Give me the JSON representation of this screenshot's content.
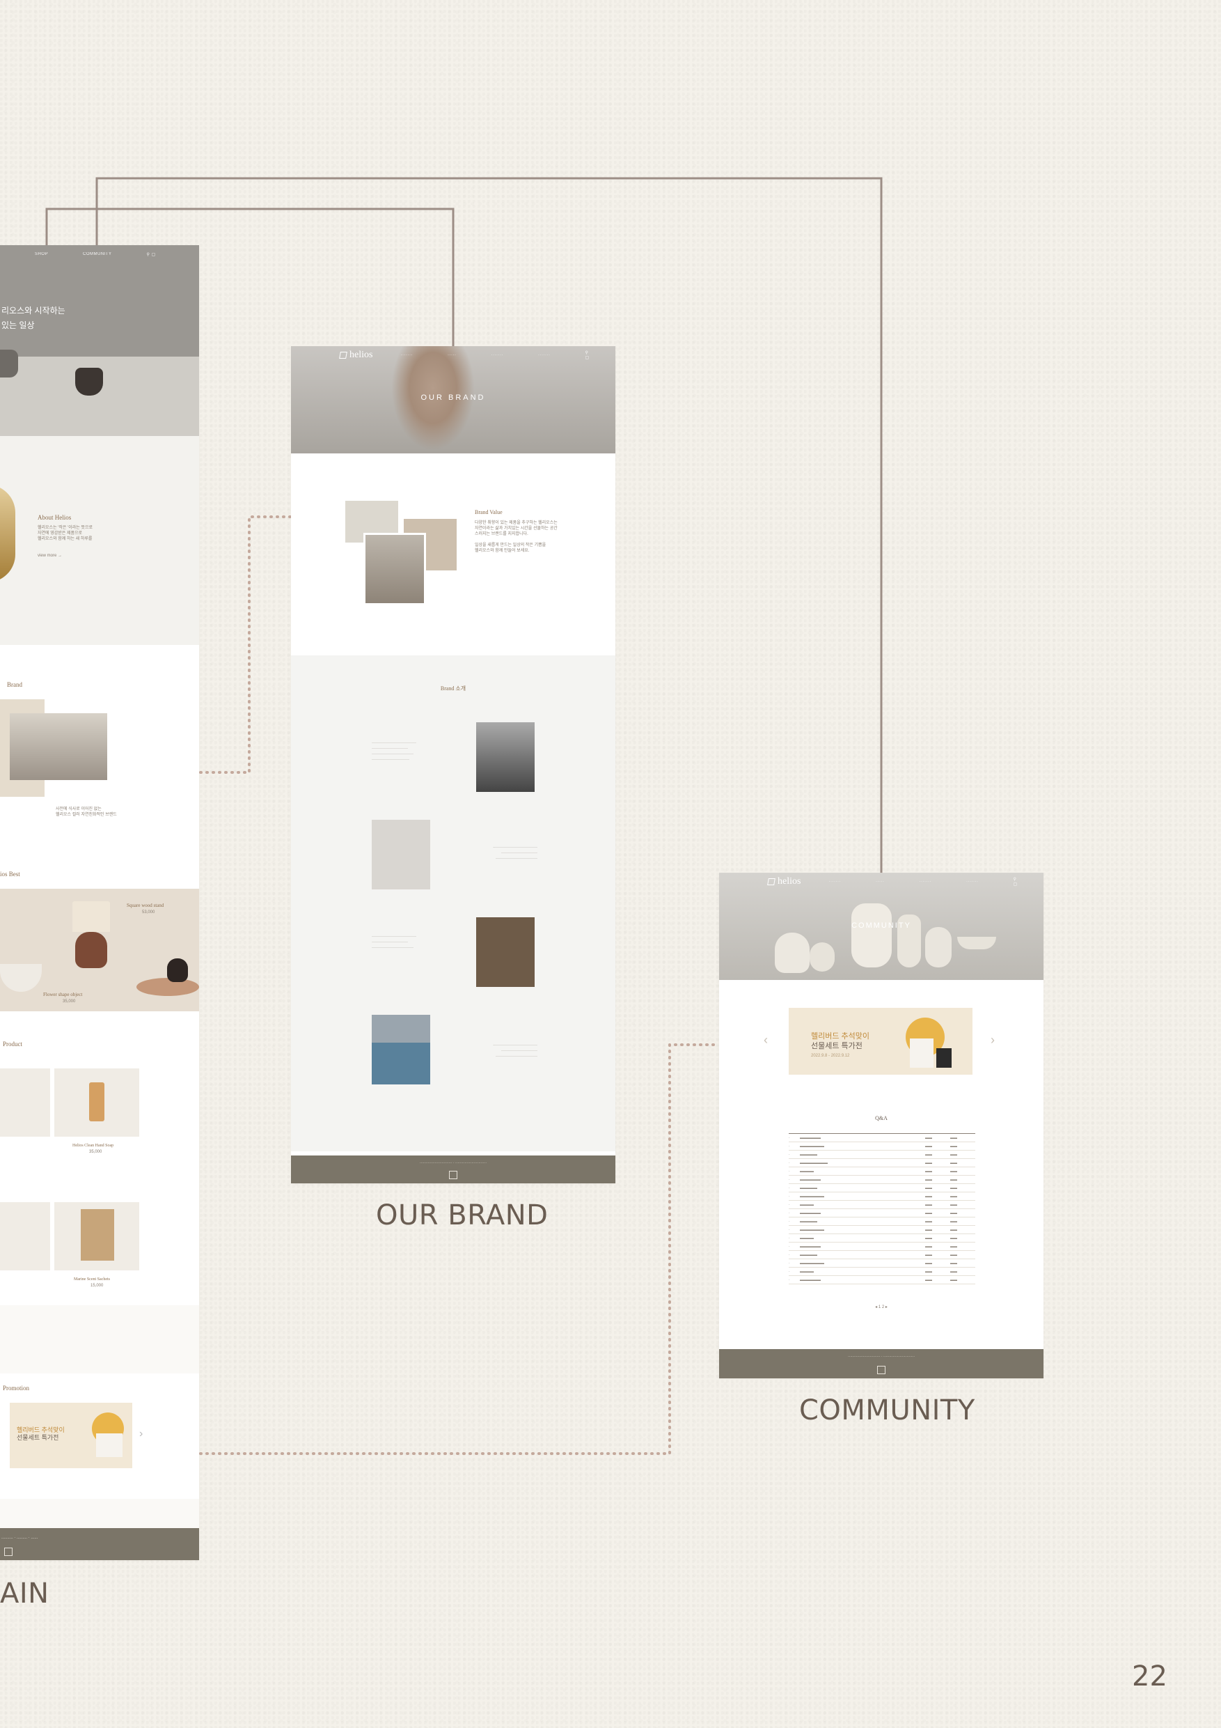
{
  "page_number": "22",
  "main": {
    "nav": [
      "SHOP",
      "COMMUNITY"
    ],
    "hero_text": [
      "리오스와 시작하는",
      "있는 일상"
    ],
    "about_title": "About Helios",
    "brand_section": "Brand",
    "best_section": "ios Best",
    "best_items": [
      {
        "name": "Square wood stand",
        "price": "53,000"
      },
      {
        "name": "Flower shape object",
        "price": "35,000"
      }
    ],
    "product_section": "Product",
    "product_items": [
      {
        "name": "Helios Clean Hand Soap",
        "price": "35,000"
      },
      {
        "name": "Marine Scent Sachets",
        "price": "15,000"
      }
    ],
    "promotion_section": "Promotion",
    "promo_text": [
      "헬리버드 추석맞이",
      "선물세트 특가전"
    ],
    "caption": "AIN"
  },
  "brand": {
    "logo": "helios",
    "hero_title": "OUR BRAND",
    "value_title": "Brand Value",
    "intro_title": "Brand 소개",
    "caption": "OUR BRAND"
  },
  "community": {
    "logo": "helios",
    "hero_title": "COMMUNITY",
    "banner": {
      "line1": "헬리버드 추석맞이",
      "line2": "선물세트 특가전",
      "dates": "2022.9.8 - 2022.9.12"
    },
    "qa_title": "Q&A",
    "caption": "COMMUNITY"
  },
  "colors": {
    "background": "#f4f1ea",
    "footer": "#7b7568",
    "connector": "#9c8d85",
    "accent": "#c08a3a"
  }
}
